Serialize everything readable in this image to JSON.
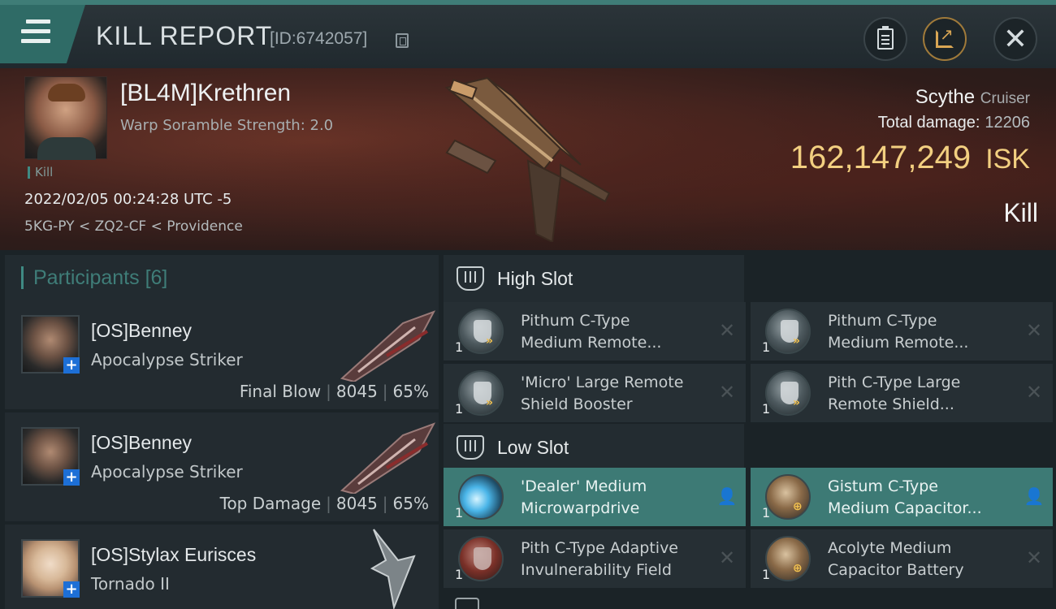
{
  "header": {
    "title": "KILL REPORT",
    "kill_id": "[ID:6742057]",
    "icons": [
      "menu-icon",
      "copy-icon",
      "clipboard-icon",
      "share-icon",
      "close-icon"
    ],
    "accent_color": "#3f7d77"
  },
  "victim": {
    "name": "[BL4M]Krethren",
    "scramble": "Warp Soramble Strength: 2.0",
    "tag": "Kill",
    "datetime": "2022/02/05 00:24:28 UTC -5",
    "location": "5KG-PY < ZQ2-CF < Providence",
    "ship_name": "Scythe",
    "ship_class": "Cruiser",
    "total_damage_label": "Total damage:",
    "total_damage": "12206",
    "isk_value": "162,147,249",
    "isk_unit": "ISK",
    "status": "Kill"
  },
  "participants": {
    "label": "Participants",
    "count": "[6]",
    "rows": [
      {
        "name": "[OS]Benney",
        "ship": "Apocalypse Striker",
        "tag": "Final Blow",
        "damage": "8045",
        "percent": "65%"
      },
      {
        "name": "[OS]Benney",
        "ship": "Apocalypse Striker",
        "tag": "Top Damage",
        "damage": "8045",
        "percent": "65%"
      },
      {
        "name": "[OS]Stylax Eurisces",
        "ship": "Tornado II"
      }
    ]
  },
  "fitting": {
    "high_slot_label": "High Slot",
    "low_slot_label": "Low Slot",
    "high": [
      {
        "name_line1": "Pithum C-Type",
        "name_line2": "Medium Remote...",
        "qty": "1"
      },
      {
        "name_line1": "Pithum C-Type",
        "name_line2": "Medium Remote...",
        "qty": "1"
      },
      {
        "name_line1": "'Micro' Large Remote",
        "name_line2": "Shield Booster",
        "qty": "1"
      },
      {
        "name_line1": "Pith C-Type Large",
        "name_line2": "Remote Shield...",
        "qty": "1"
      }
    ],
    "low": [
      {
        "name_line1": "'Dealer' Medium",
        "name_line2": "Microwarpdrive",
        "qty": "1"
      },
      {
        "name_line1": "Gistum C-Type",
        "name_line2": "Medium Capacitor...",
        "qty": "1"
      },
      {
        "name_line1": "Pith C-Type Adaptive",
        "name_line2": "Invulnerability Field",
        "qty": "1"
      },
      {
        "name_line1": "Acolyte Medium",
        "name_line2": "Capacitor Battery",
        "qty": "1"
      }
    ]
  }
}
